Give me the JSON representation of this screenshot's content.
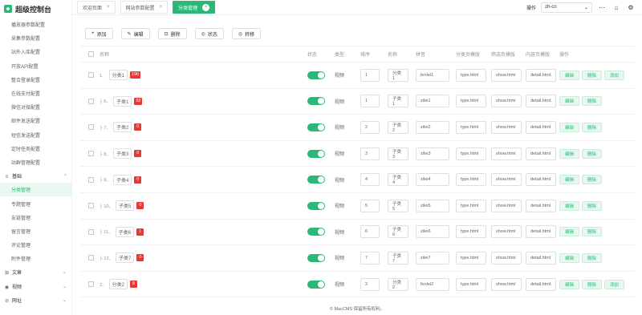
{
  "app": {
    "title": "超级控制台"
  },
  "sidebar": {
    "items_top": [
      "播放器参数配置",
      "采集参数配置",
      "站外入库配置",
      "开放API配置",
      "整合登录配置",
      "在线支付配置",
      "微信对接配置",
      "邮件发送配置",
      "短信发送配置",
      "定时任务配置",
      "站群管理配置"
    ],
    "group_basic": {
      "label": "基础",
      "icon": "≡"
    },
    "items_basic": [
      "分类管理",
      "专题管理",
      "友链管理",
      "留言管理",
      "评论管理",
      "附件管理"
    ],
    "group_article": {
      "label": "文章",
      "icon": "⊞"
    },
    "group_video": {
      "label": "视频",
      "icon": "◉"
    },
    "group_site": {
      "label": "网址",
      "icon": "⊘"
    }
  },
  "tabs": [
    {
      "label": "欢迎页面",
      "close": "×"
    },
    {
      "label": "网站参数配置",
      "close": "×"
    },
    {
      "label": "分类管理",
      "close": "×"
    }
  ],
  "topbar": {
    "op_label": "操作",
    "lang_value": "zh-cn",
    "lang_arrow": "⌄"
  },
  "toolbar": {
    "add": "添加",
    "edit": "编辑",
    "del": "删除",
    "status": "状态",
    "move": "转移"
  },
  "table": {
    "headers": {
      "name": "名称",
      "status": "状态",
      "type": "类型",
      "sort": "排序",
      "cname": "名称",
      "pinyin": "拼音",
      "tpl1": "分类页模版",
      "tpl2": "筛选页模版",
      "tpl3": "内容页模版",
      "ops": "操作"
    },
    "rows": [
      {
        "tree": "1、",
        "name": "分类1",
        "count": "190",
        "type": "视频",
        "sort": "1",
        "cname": "分类1",
        "pinyin": "fenlei1",
        "tpl1": "type.html",
        "tpl2": "show.html",
        "tpl3": "detail.html",
        "ops": [
          "编辑",
          "删除",
          "添加"
        ]
      },
      {
        "tree": "├ 6、",
        "name": "子类1",
        "count": "92",
        "type": "视频",
        "sort": "1",
        "cname": "子类1",
        "pinyin": "zilei1",
        "tpl1": "type.html",
        "tpl2": "show.html",
        "tpl3": "detail.html",
        "ops": [
          "编辑",
          "删除"
        ]
      },
      {
        "tree": "├ 7、",
        "name": "子类2",
        "count": "0",
        "type": "视频",
        "sort": "2",
        "cname": "子类2",
        "pinyin": "zilei2",
        "tpl1": "type.html",
        "tpl2": "show.html",
        "tpl3": "detail.html",
        "ops": [
          "编辑",
          "删除"
        ]
      },
      {
        "tree": "├ 8、",
        "name": "子类3",
        "count": "0",
        "type": "视频",
        "sort": "3",
        "cname": "子类3",
        "pinyin": "zilei3",
        "tpl1": "type.html",
        "tpl2": "show.html",
        "tpl3": "detail.html",
        "ops": [
          "编辑",
          "删除"
        ]
      },
      {
        "tree": "├ 9、",
        "name": "子类4",
        "count": "0",
        "type": "视频",
        "sort": "4",
        "cname": "子类4",
        "pinyin": "zilei4",
        "tpl1": "type.html",
        "tpl2": "show.html",
        "tpl3": "detail.html",
        "ops": [
          "编辑",
          "删除"
        ]
      },
      {
        "tree": "├ 10、",
        "name": "子类5",
        "count": "0",
        "type": "视频",
        "sort": "5",
        "cname": "子类5",
        "pinyin": "zilei5",
        "tpl1": "type.html",
        "tpl2": "show.html",
        "tpl3": "detail.html",
        "ops": [
          "编辑",
          "删除"
        ]
      },
      {
        "tree": "├ 11、",
        "name": "子类6",
        "count": "1",
        "type": "视频",
        "sort": "6",
        "cname": "子类6",
        "pinyin": "zilei6",
        "tpl1": "type.html",
        "tpl2": "show.html",
        "tpl3": "detail.html",
        "ops": [
          "编辑",
          "删除"
        ]
      },
      {
        "tree": "├ 12、",
        "name": "子类7",
        "count": "0",
        "type": "视频",
        "sort": "7",
        "cname": "子类7",
        "pinyin": "zilei7",
        "tpl1": "type.html",
        "tpl2": "show.html",
        "tpl3": "detail.html",
        "ops": [
          "编辑",
          "删除"
        ]
      },
      {
        "tree": "2、",
        "name": "分类2",
        "count": "8",
        "type": "视频",
        "sort": "2",
        "cname": "分类2",
        "pinyin": "fenlei2",
        "tpl1": "type.html",
        "tpl2": "show.html",
        "tpl3": "detail.html",
        "ops": [
          "编辑",
          "删除",
          "添加"
        ]
      }
    ]
  },
  "footer": {
    "text": "© MacCMS 保留所有权利。"
  },
  "colors": {
    "accent": "#2bb876",
    "badge": "#e53935"
  },
  "icons": {
    "home": "⌂",
    "more": "⋯",
    "add": "+",
    "edit": "✎",
    "del": "🗑",
    "status": "◎",
    "move": "◎"
  }
}
